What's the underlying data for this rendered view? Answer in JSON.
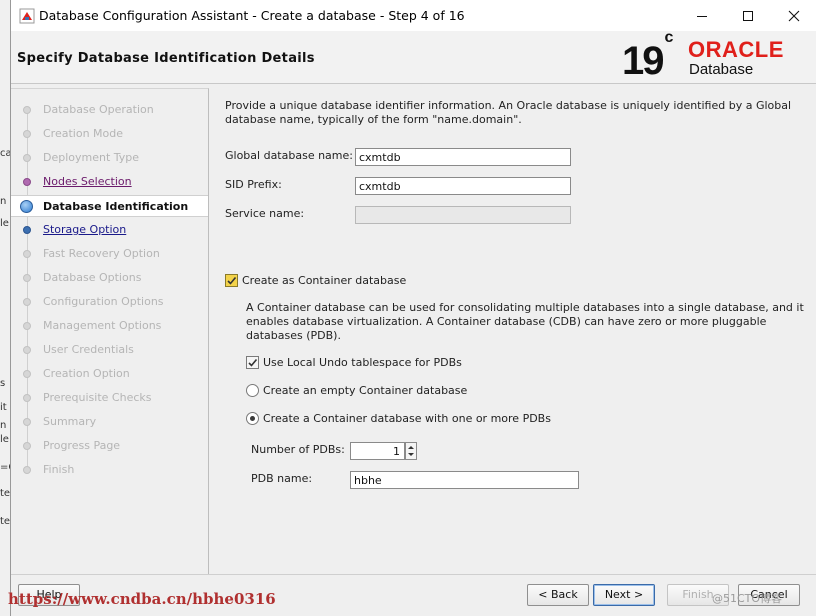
{
  "window": {
    "title": "Database Configuration Assistant - Create a database - Step 4 of 16"
  },
  "header": {
    "page_title": "Specify Database Identification Details",
    "logo_version": "19",
    "logo_sup": "c",
    "logo_brand": "ORACLE",
    "logo_product": "Database"
  },
  "steps": [
    {
      "label": "Database Operation",
      "state": "disabled"
    },
    {
      "label": "Creation Mode",
      "state": "disabled"
    },
    {
      "label": "Deployment Type",
      "state": "disabled"
    },
    {
      "label": "Nodes Selection",
      "state": "visited"
    },
    {
      "label": "Database Identification",
      "state": "current"
    },
    {
      "label": "Storage Option",
      "state": "link"
    },
    {
      "label": "Fast Recovery Option",
      "state": "disabled"
    },
    {
      "label": "Database Options",
      "state": "disabled"
    },
    {
      "label": "Configuration Options",
      "state": "disabled"
    },
    {
      "label": "Management Options",
      "state": "disabled"
    },
    {
      "label": "User Credentials",
      "state": "disabled"
    },
    {
      "label": "Creation Option",
      "state": "disabled"
    },
    {
      "label": "Prerequisite Checks",
      "state": "disabled"
    },
    {
      "label": "Summary",
      "state": "disabled"
    },
    {
      "label": "Progress Page",
      "state": "disabled"
    },
    {
      "label": "Finish",
      "state": "disabled"
    }
  ],
  "content": {
    "intro_line1": "Provide a unique database identifier information. An Oracle database is uniquely identified by a Global",
    "intro_line2": "database name, typically of the form \"name.domain\".",
    "global_db_label": "Global database name:",
    "global_db_value": "cxmtdb",
    "sid_label": "SID Prefix:",
    "sid_value": "cxmtdb",
    "service_label": "Service name:",
    "service_value": "",
    "container_label": "Create as Container database",
    "container_checked": true,
    "container_desc1": "A Container database can be used for consolidating multiple databases into a single database, and it",
    "container_desc2": "enables database virtualization. A Container database (CDB) can have zero or more pluggable",
    "container_desc3": "databases (PDB).",
    "undo_label": "Use Local Undo tablespace for PDBs",
    "undo_checked": true,
    "empty_cdb_label": "Create an empty Container database",
    "with_pdbs_label": "Create a Container database with one or more PDBs",
    "selected_option": "with_pdbs",
    "num_pdbs_label": "Number of PDBs:",
    "num_pdbs_value": "1",
    "pdb_name_label": "PDB name:",
    "pdb_name_value": "hbhe"
  },
  "footer": {
    "help": "Help",
    "back": "< Back",
    "next": "Next >",
    "finish": "Finish",
    "cancel": "Cancel"
  },
  "overlay": {
    "watermark": "https://www.cndba.cn/hbhe0316",
    "watermark2": "@51CTO博客"
  },
  "bleed_text": [
    "ca",
    "n",
    "le",
    "s",
    "it",
    "n",
    "le",
    "=C",
    "te",
    "te"
  ],
  "colors": {
    "oracle_red": "#e0201b",
    "link_blue": "#1a1a8a",
    "visited_purple": "#6b1a6b",
    "current_dot": "#2e7bd0"
  }
}
